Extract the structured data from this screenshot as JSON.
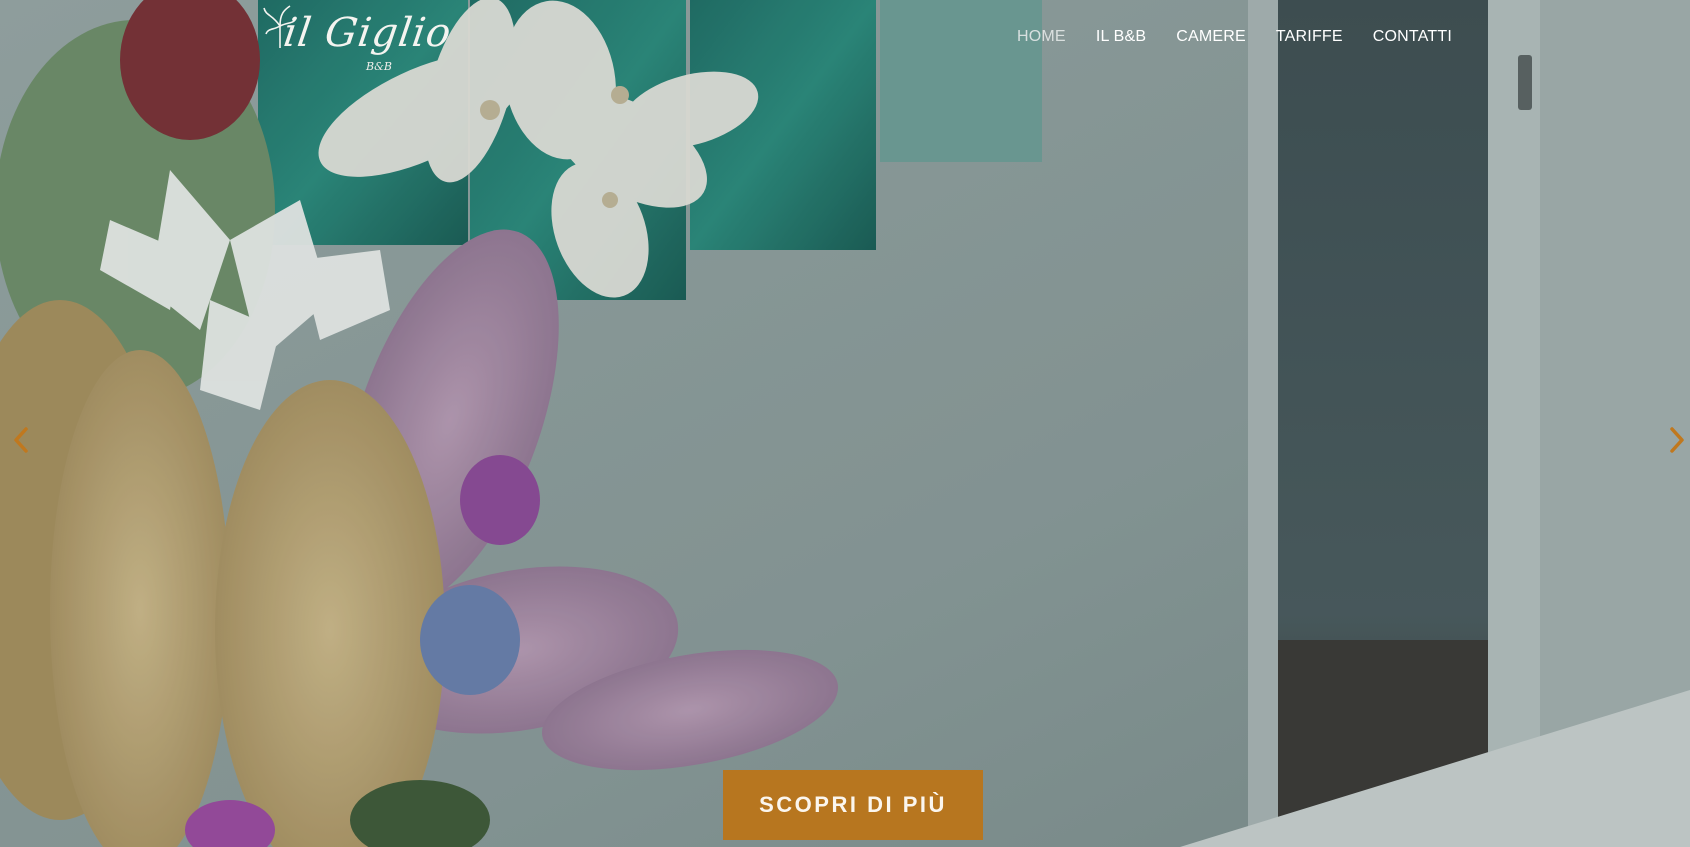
{
  "brand": {
    "name": "il Giglio",
    "subtitle": "B&B"
  },
  "nav": {
    "items": [
      {
        "label": "HOME",
        "active": true
      },
      {
        "label": "IL B&B",
        "active": false
      },
      {
        "label": "CAMERE",
        "active": false
      },
      {
        "label": "TARIFFE",
        "active": false
      },
      {
        "label": "CONTATTI",
        "active": false
      }
    ]
  },
  "slider": {
    "prev_icon": "chevron-left-icon",
    "next_icon": "chevron-right-icon",
    "cta_label": "SCOPRI DI PIÙ"
  },
  "colors": {
    "accent": "#b7761f",
    "nav_text": "#ffffff",
    "arrow": "#c0781e"
  }
}
